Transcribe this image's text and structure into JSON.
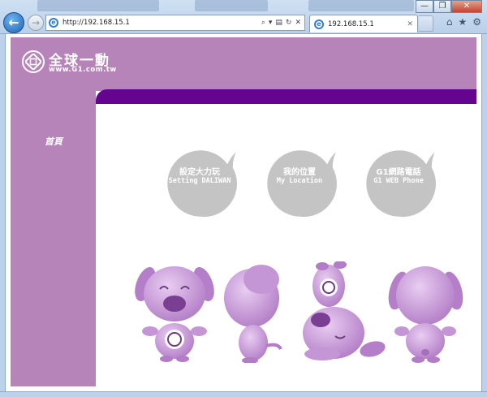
{
  "browser": {
    "url": "http://192.168.15.1",
    "tab_title": "192.168.15.1",
    "window_controls": [
      "—",
      "❐",
      "✕"
    ],
    "toolbar_icons": [
      "home-icon",
      "star-icon",
      "gear-icon"
    ]
  },
  "site": {
    "brand_cn": "全球一動",
    "brand_url": "www.G1.com.tw",
    "nav": {
      "home": "首頁"
    },
    "menu": [
      {
        "cn": "設定大力玩",
        "en": "Setting DALIWAN"
      },
      {
        "cn": "我的位置",
        "en": "My Location"
      },
      {
        "cn": "G1網路電話",
        "en": "G1 WEB Phone"
      }
    ],
    "colors": {
      "header": "#b684b8",
      "accent_bar": "#65058f",
      "bubble": "#c4c4c4",
      "mascot": "#c79ad6"
    }
  }
}
